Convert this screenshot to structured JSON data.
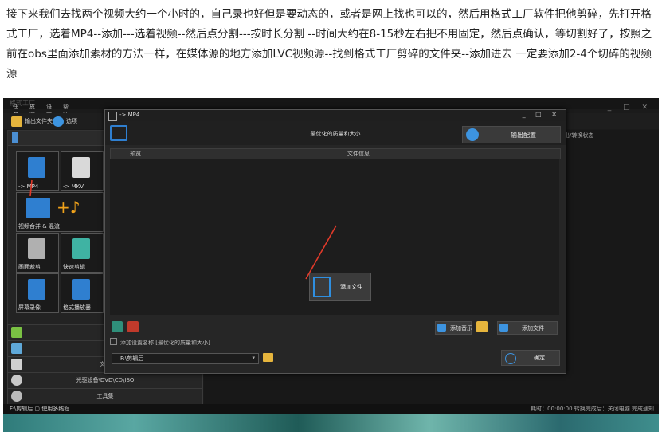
{
  "article": {
    "text": "接下来我们去找两个视频大约一个小时的，自己录也好但是要动态的，或者是网上找也可以的，然后用格式工厂软件把他剪碎，先打开格式工厂，选着MP4--添加---选着视频--然后点分割---按时长分割 --时间大约在8-15秒左右把不用固定，然后点确认，等切割好了，按照之前在obs里面添加素材的方法一样，在媒体源的地方添加LVC视频源--找到格式工厂剪碎的文件夹--添加进去  一定要添加2-4个切碎的视频源"
  },
  "format_factory": {
    "window_title": "格式工厂",
    "menus": [
      "任务",
      "皮肤",
      "语言",
      "帮助"
    ],
    "toolbar": {
      "output_folder": "输出文件夹",
      "options": "选项"
    },
    "tiles": [
      {
        "label": "-> MP4",
        "icon": "mp4-file-icon",
        "color": "#2f7fd0"
      },
      {
        "label": "-> MKV",
        "icon": "video-file-icon",
        "color": "#d9d9d9"
      },
      {
        "label": "视频合并 & 混流",
        "icon": "merge-video-icon",
        "color": "#2f7fd0"
      },
      {
        "label": "画面裁剪",
        "icon": "scissors-icon",
        "color": "#b0b0b0"
      },
      {
        "label": "快速剪辑",
        "icon": "cut-icon",
        "color": "#3fb3a3"
      },
      {
        "label": "屏幕录像",
        "icon": "screen-record-icon",
        "color": "#2f7fd0"
      },
      {
        "label": "格式播放器",
        "icon": "player-icon",
        "color": "#2f7fd0"
      }
    ],
    "category_rows": [
      {
        "label": "",
        "icon": "music-icon"
      },
      {
        "label": "",
        "icon": "picture-icon"
      },
      {
        "label": "文档",
        "icon": "document-icon"
      },
      {
        "label": "光驱设备\\DVD\\CD\\ISO",
        "icon": "disc-icon"
      },
      {
        "label": "工具集",
        "icon": "tools-icon"
      }
    ],
    "right_column_header": "输出/转换状态",
    "status_left": "F:\\剪辑后",
    "status_mid": "使用多线程",
    "status_right": "耗时：00:00:00  转换完成后：关闭电脑  完成通知",
    "colors": {
      "accent": "#2f7fd0",
      "arrow": "#e23a2a"
    }
  },
  "dialog": {
    "title": "-> MP4",
    "window_controls": "_ □ ✕",
    "quality_label": "最优化的质量和大小",
    "output_config": "输出配置",
    "columns": [
      "预览",
      "文件信息"
    ],
    "center_add_file": "添加文件",
    "add_music": "添加音乐",
    "add_file": "添加文件",
    "checkbox_label": "添加设置名称 [最优化的质量和大小]",
    "output_path": "F:\\剪辑后",
    "ok": "确定"
  }
}
